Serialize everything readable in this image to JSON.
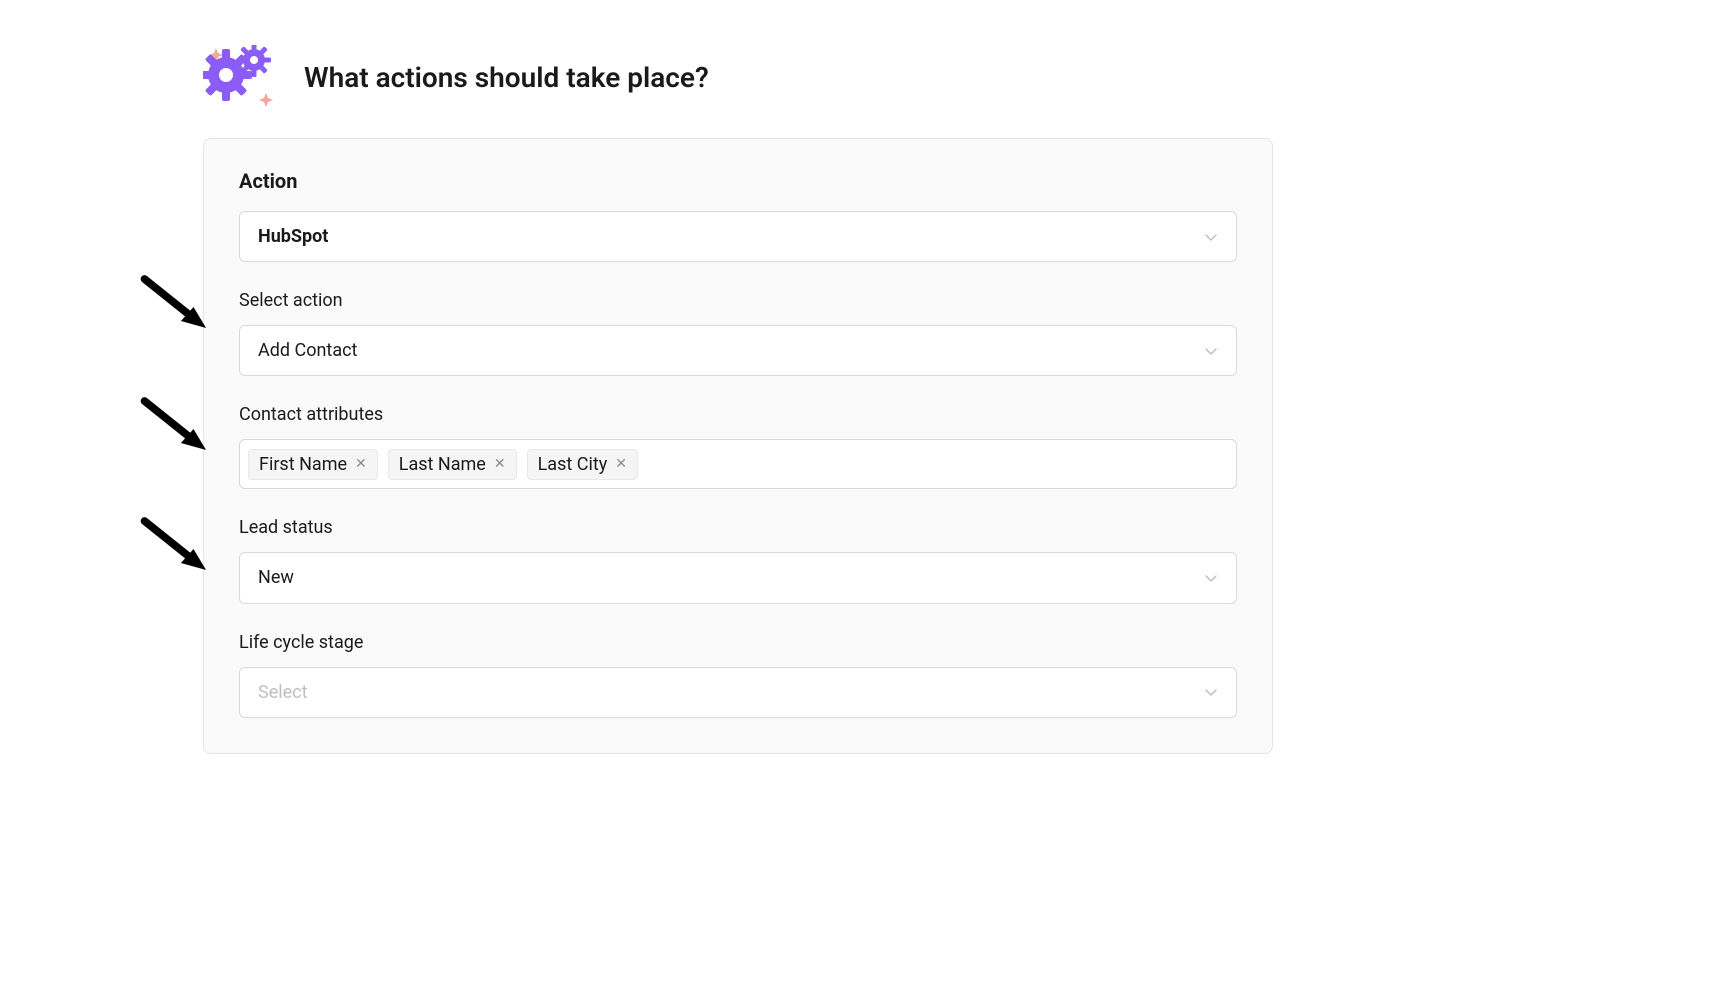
{
  "header": {
    "title": "What actions should take place?"
  },
  "panel": {
    "section_label": "Action",
    "integration_select": {
      "value": "HubSpot"
    },
    "action_select": {
      "label": "Select action",
      "value": "Add Contact"
    },
    "contact_attributes": {
      "label": "Contact attributes",
      "tags": [
        "First Name",
        "Last Name",
        "Last City"
      ]
    },
    "lead_status": {
      "label": "Lead status",
      "value": "New"
    },
    "life_cycle_stage": {
      "label": "Life cycle stage",
      "placeholder": "Select"
    }
  }
}
